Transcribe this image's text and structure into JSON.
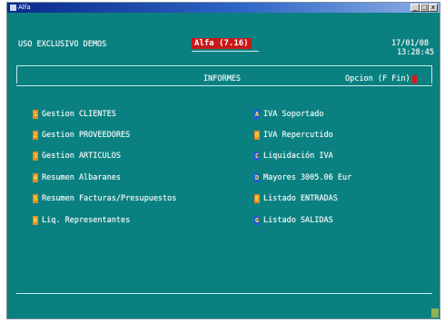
{
  "window": {
    "title": "Alfa"
  },
  "header": {
    "left": "USO EXCLUSIVO DEMOS",
    "product": "Alfa (7.16)",
    "date": "17/01/08",
    "time": "13:28:45"
  },
  "bar": {
    "title": "INFORMES",
    "prompt": "Opcion (F Fin)"
  },
  "menu_left": [
    {
      "key": "1",
      "label": "Gestion CLIENTES"
    },
    {
      "key": "2",
      "label": "Gestion PROVEEDORES"
    },
    {
      "key": "3",
      "label": "Gestion ARTICULOS"
    },
    {
      "key": "4",
      "label": "Resumen Albaranes"
    },
    {
      "key": "5",
      "label": "Resumen Facturas/Presupuestos"
    },
    {
      "key": "6",
      "label": "Liq. Representantes"
    }
  ],
  "menu_right": [
    {
      "key": "A",
      "label": "IVA Soportado"
    },
    {
      "key": "B",
      "label": "IVA Repercutido"
    },
    {
      "key": "C",
      "label": "Liquidación IVA"
    },
    {
      "key": "D",
      "label": "Mayores 3005.06 Eur"
    },
    {
      "key": "E",
      "label": "Listado ENTRADAS"
    },
    {
      "key": "G",
      "label": "Listado SALIDAS"
    }
  ],
  "colors": {
    "background": "#0a8080",
    "hotkey_left": "#2858d8",
    "hotkey_right": "#2858d8",
    "alert": "#c81818"
  }
}
